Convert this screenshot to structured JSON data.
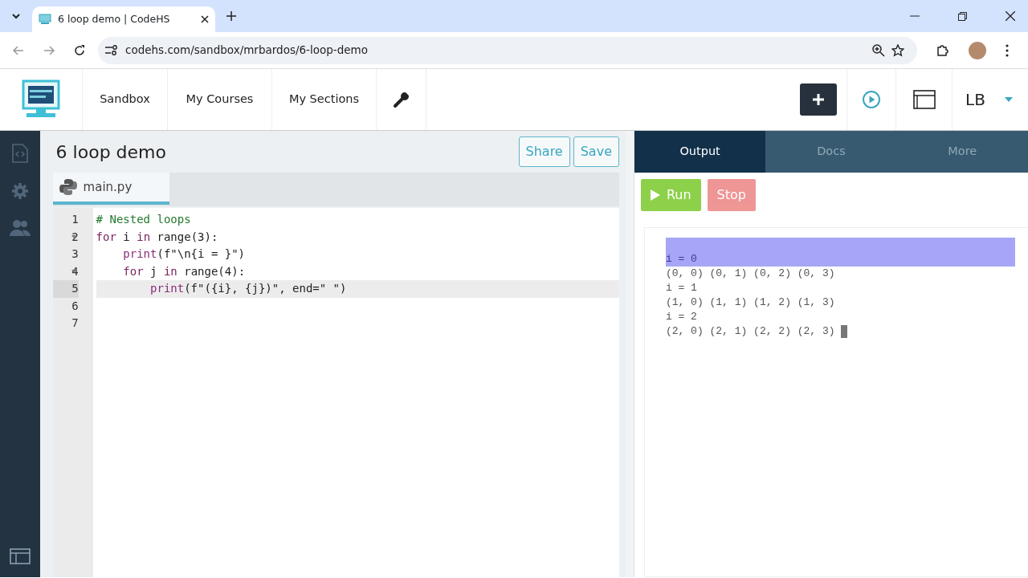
{
  "browser": {
    "tab_title": "6 loop demo | CodeHS",
    "url": "codehs.com/sandbox/mrbardos/6-loop-demo"
  },
  "nav": {
    "items": [
      {
        "label": "Sandbox"
      },
      {
        "label": "My Courses"
      },
      {
        "label": "My Sections"
      }
    ],
    "user_initials": "LB"
  },
  "project": {
    "title": "6 loop demo",
    "buttons": [
      "Share",
      "Save"
    ],
    "file_tab": "main.py"
  },
  "editor": {
    "lines": [
      {
        "number": "1",
        "foldable": false,
        "selected": false,
        "tokens": [
          {
            "text": "# Nested loops",
            "kind": "comment"
          }
        ]
      },
      {
        "number": "2",
        "foldable": true,
        "selected": false,
        "tokens": [
          {
            "text": "for",
            "kind": "keyword"
          },
          {
            "text": " i ",
            "kind": "plain"
          },
          {
            "text": "in",
            "kind": "keyword"
          },
          {
            "text": " range(3):",
            "kind": "plain"
          }
        ]
      },
      {
        "number": "3",
        "foldable": false,
        "selected": false,
        "tokens": [
          {
            "text": "    print",
            "kind": "builtin"
          },
          {
            "text": "(f\"\\n{i = }\")",
            "kind": "plain"
          }
        ]
      },
      {
        "number": "4",
        "foldable": true,
        "selected": false,
        "tokens": [
          {
            "text": "    for",
            "kind": "keyword"
          },
          {
            "text": " j ",
            "kind": "plain"
          },
          {
            "text": "in",
            "kind": "keyword"
          },
          {
            "text": " range(4):",
            "kind": "plain"
          }
        ]
      },
      {
        "number": "5",
        "foldable": false,
        "selected": true,
        "tokens": [
          {
            "text": "        print",
            "kind": "builtin"
          },
          {
            "text": "(f\"({i}, {j})\", end=\" \")",
            "kind": "plain"
          }
        ]
      },
      {
        "number": "6",
        "foldable": false,
        "selected": false
      },
      {
        "number": "7",
        "foldable": false,
        "selected": false
      }
    ]
  },
  "panel": {
    "tabs": [
      {
        "label": "Output",
        "selected": true
      },
      {
        "label": "Docs",
        "selected": false
      },
      {
        "label": "More",
        "selected": false
      }
    ],
    "run_label": "Run",
    "stop_label": "Stop",
    "stop_disabled": true
  },
  "console": {
    "cursor": true,
    "lines": [
      {
        "text": "i = 0",
        "selected": true
      },
      {
        "text": "(0, 0) (0, 1) (0, 2) (0, 3)",
        "selected": false
      },
      {
        "text": "i = 1",
        "selected": false
      },
      {
        "text": "(1, 0) (1, 1) (1, 2) (1, 3)",
        "selected": false
      },
      {
        "text": "i = 2",
        "selected": false
      },
      {
        "text": "(2, 0) (2, 1) (2, 2) (2, 3)",
        "selected": false
      }
    ]
  }
}
